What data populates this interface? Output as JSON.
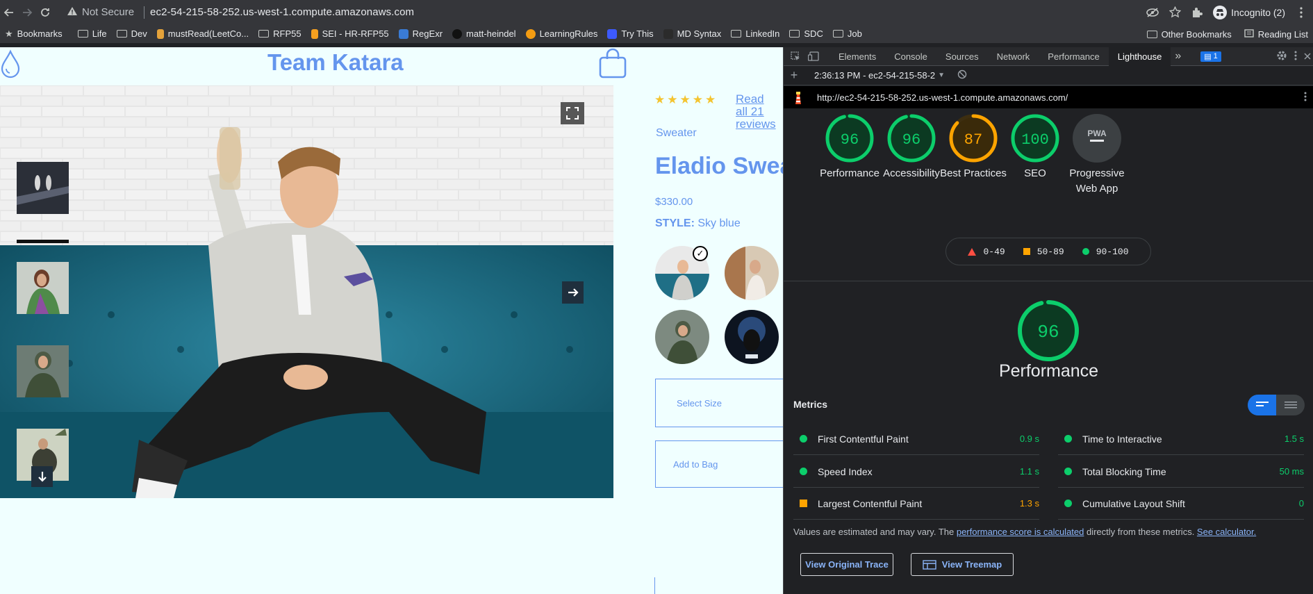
{
  "browser": {
    "security_label": "Not Secure",
    "url": "ec2-54-215-58-252.us-west-1.compute.amazonaws.com",
    "profile_label": "Incognito (2)"
  },
  "bookmarks": {
    "items": [
      {
        "label": "Bookmarks",
        "icon": "bookmarks-star-icon"
      },
      {
        "label": "Life",
        "icon": "folder-icon"
      },
      {
        "label": "Dev",
        "icon": "folder-icon"
      },
      {
        "label": "mustRead(LeetCo...",
        "icon": "favicon"
      },
      {
        "label": "RFP55",
        "icon": "folder-icon"
      },
      {
        "label": "SEI - HR-RFP55",
        "icon": "favicon"
      },
      {
        "label": "RegExr",
        "icon": "favicon"
      },
      {
        "label": "matt-heindel",
        "icon": "github-icon"
      },
      {
        "label": "LearningRules",
        "icon": "favicon"
      },
      {
        "label": "Try This",
        "icon": "favicon"
      },
      {
        "label": "MD Syntax",
        "icon": "favicon"
      },
      {
        "label": "LinkedIn",
        "icon": "folder-icon"
      },
      {
        "label": "SDC",
        "icon": "folder-icon"
      },
      {
        "label": "Job",
        "icon": "folder-icon"
      }
    ],
    "other_label": "Other Bookmarks",
    "reading_list_label": "Reading List"
  },
  "page": {
    "brand": "Team Katara",
    "rating_stars": "★★★★★",
    "read_reviews": "Read all 21 reviews",
    "category": "Sweater",
    "product_name": "Eladio Sweater",
    "price": "$330.00",
    "style_label": "STYLE:",
    "style_value": "Sky blue",
    "select_size": "Select Size",
    "add_to_bag": "Add to Bag",
    "bottom_text": "... ..... ... ...... ..... ....."
  },
  "devtools": {
    "tabs": [
      "Elements",
      "Console",
      "Sources",
      "Network",
      "Performance",
      "Lighthouse"
    ],
    "active_tab": "Lighthouse",
    "more_tabs": "»",
    "issues_count": "1",
    "report_label": "2:36:13 PM - ec2-54-215-58-2",
    "audited_url": "http://ec2-54-215-58-252.us-west-1.compute.amazonaws.com/",
    "scores": [
      {
        "label": "Performance",
        "score": "96",
        "value": 96,
        "color": "#0cce6b"
      },
      {
        "label": "Accessibility",
        "score": "96",
        "value": 96,
        "color": "#0cce6b"
      },
      {
        "label": "Best Practices",
        "score": "87",
        "value": 87,
        "color": "#ffa400"
      },
      {
        "label": "SEO",
        "score": "100",
        "value": 100,
        "color": "#0cce6b"
      },
      {
        "label": "Progressive Web App",
        "score": "PWA",
        "value": 0,
        "color": "#9aa0a6"
      }
    ],
    "legend": [
      {
        "range": "0-49",
        "color": "#ff4e42",
        "shape": "triangle"
      },
      {
        "range": "50-89",
        "color": "#ffa400",
        "shape": "square"
      },
      {
        "range": "90-100",
        "color": "#0cce6b",
        "shape": "circle"
      }
    ],
    "big_score": "96",
    "big_score_value": 96,
    "big_title": "Performance",
    "metrics_heading": "Metrics",
    "metrics": [
      {
        "name": "First Contentful Paint",
        "value": "0.9 s",
        "status": "pass",
        "color": "#0cce6b"
      },
      {
        "name": "Time to Interactive",
        "value": "1.5 s",
        "status": "pass",
        "color": "#0cce6b"
      },
      {
        "name": "Speed Index",
        "value": "1.1 s",
        "status": "pass",
        "color": "#0cce6b"
      },
      {
        "name": "Total Blocking Time",
        "value": "50 ms",
        "status": "pass",
        "color": "#0cce6b"
      },
      {
        "name": "Largest Contentful Paint",
        "value": "1.3 s",
        "status": "average",
        "color": "#ffa400"
      },
      {
        "name": "Cumulative Layout Shift",
        "value": "0",
        "status": "pass",
        "color": "#0cce6b"
      }
    ],
    "note_pre": "Values are estimated and may vary. The ",
    "note_link1": "performance score is calculated",
    "note_mid": " directly from these metrics. ",
    "note_link2": "See calculator.",
    "view_trace": "View Original Trace",
    "view_treemap": "View Treemap"
  }
}
